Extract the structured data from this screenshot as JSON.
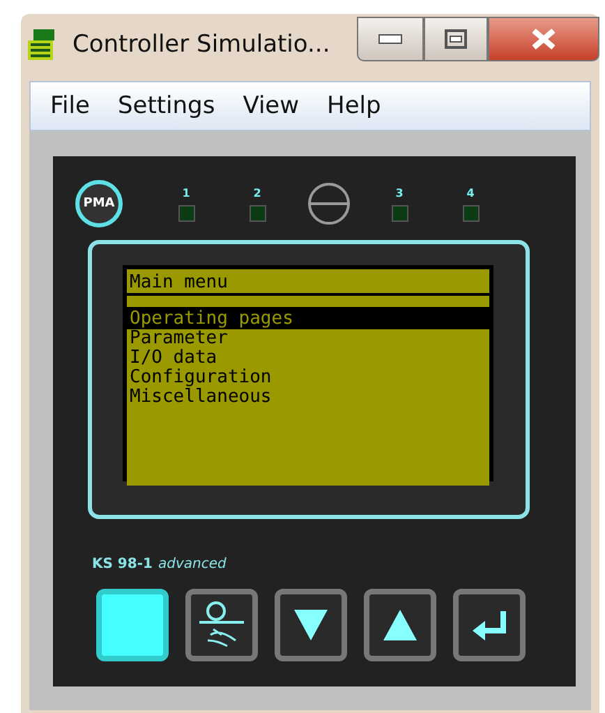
{
  "window": {
    "title": "Controller Simulatio..."
  },
  "menu": [
    {
      "label": "File"
    },
    {
      "label": "Settings"
    },
    {
      "label": "View"
    },
    {
      "label": "Help"
    }
  ],
  "device": {
    "logo": "PMA",
    "leds": [
      {
        "label": "1",
        "on": false
      },
      {
        "label": "2",
        "on": false
      },
      {
        "label": "3",
        "on": false
      },
      {
        "label": "4",
        "on": false
      }
    ],
    "display": {
      "title": "Main menu",
      "items": [
        {
          "label": "Operating pages",
          "selected": true
        },
        {
          "label": "Parameter",
          "selected": false
        },
        {
          "label": "I/O data",
          "selected": false
        },
        {
          "label": "Configuration",
          "selected": false
        },
        {
          "label": "Miscellaneous",
          "selected": false
        }
      ]
    },
    "model": {
      "name": "KS 98-1",
      "variant": "advanced"
    },
    "keys": [
      {
        "kind": "function"
      },
      {
        "kind": "manual"
      },
      {
        "kind": "down"
      },
      {
        "kind": "up"
      },
      {
        "kind": "enter"
      }
    ]
  }
}
